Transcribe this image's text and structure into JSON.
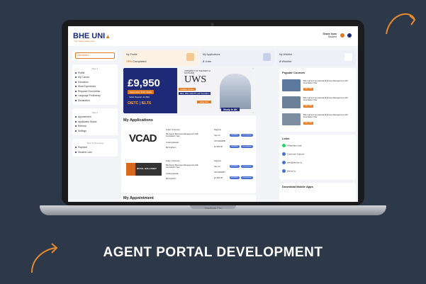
{
  "caption": "AGENT PORTAL DEVELOPMENT",
  "laptop_brand": "MacBook Pro",
  "app": {
    "logo": "BHE UNI",
    "logo_sub": "Your future starts here",
    "user_name": "Shane Isom",
    "user_role": "Student",
    "sidebar": {
      "dashboard": "Dashboard",
      "group1_head": "Step 1",
      "group1": [
        "Profile",
        "My Course",
        "Education",
        "Work Experience",
        "Required Documents",
        "Language Proficiency",
        "Declaration"
      ],
      "group2_head": "Step 2",
      "group2": [
        "Appointment",
        "Application Status",
        "Referral",
        "Settings"
      ],
      "group3_head": "Step 3 Upcoming",
      "group3": [
        "Payment",
        "Student Loan"
      ]
    },
    "stats": [
      {
        "title": "My Profile",
        "value": "75%",
        "suffix": "Completed"
      },
      {
        "title": "My Applications",
        "value": "2",
        "suffix": "Jobs"
      },
      {
        "title": "My Wishlist",
        "value": "2",
        "suffix": "Wishlist"
      }
    ],
    "banner": {
      "price": "£9,950",
      "intake": "September 2024 Intake",
      "deposit": "Initial Deposit: £1,500",
      "tests": "OIETC | IELTS",
      "uni_small": "UNIVERSITY OF THE WEST of SCOTLAND",
      "uni_big": "UWS",
      "courses_tag": "Available Courses",
      "courses": "BBA | MBA | MSc/PG with Specialism",
      "apply": "Apply Now",
      "study": "Study in UK"
    },
    "applications_title": "My Applications",
    "applications": [
      {
        "logo": "VCAD",
        "university": "Arden University",
        "course": "BA (Hons) Business Management with Foundation Year",
        "level": "Undergraduate",
        "city": "Birmingham",
        "mode": "Daytime",
        "intake": "Sep 24",
        "ref": "STU0000058",
        "fee": "£4,950.00",
        "status1": "Enrolled",
        "status2": "Unconditional Offer",
        "status3": "Enrolled",
        "status4": "Unconditional Offer"
      },
      {
        "logo": "ROYAL HOLLOWAY",
        "university": "Arden University",
        "course": "BA (Hons) Business Management with Foundation Year",
        "level": "Undergraduate",
        "city": "Birmingham",
        "mode": "Daytime",
        "intake": "Sep 24",
        "ref": "STU0000057",
        "fee": "£4,950.00",
        "status1": "Enrolled",
        "status2": "Unconditional Offer",
        "status3": "Enrolled",
        "status4": "Unconditional Offer"
      }
    ],
    "appointment_title": "My Appointment",
    "popular_title": "Popular Courses",
    "popular": [
      {
        "text": "BSc (Hons) International Business Management with Foundation Year",
        "btn": "Apply Now"
      },
      {
        "text": "BSc (Hons) International Business Management with Foundation Year",
        "btn": "Apply Now"
      },
      {
        "text": "BSc (Hons) International Business Management with Foundation Year",
        "btn": "Apply Now"
      }
    ],
    "links_title": "Links",
    "links": [
      "WhatsApp chat",
      "Customer Support",
      "care@bheuni.io",
      "bheuni.io"
    ],
    "download_title": "Download Mobile Apps"
  }
}
